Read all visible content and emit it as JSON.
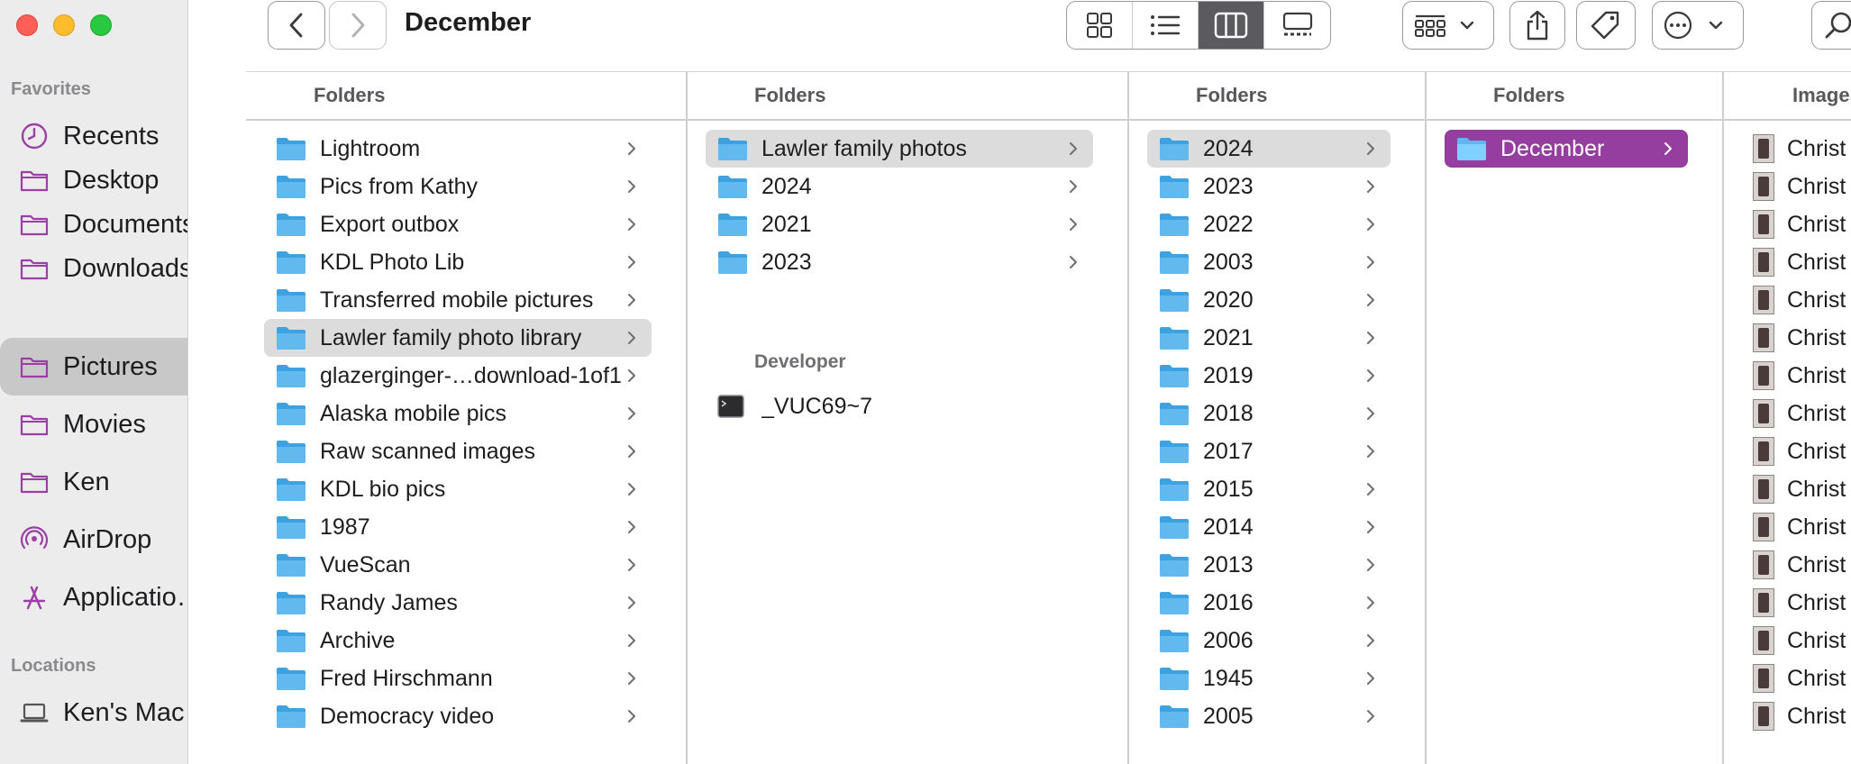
{
  "window": {
    "title": "December"
  },
  "sidebar": {
    "sections": [
      {
        "label": "Favorites",
        "items": [
          {
            "label": "Recents",
            "icon": "clock-icon",
            "selected": false
          },
          {
            "label": "Desktop",
            "icon": "folder-icon",
            "selected": false
          },
          {
            "label": "Documents",
            "icon": "folder-icon",
            "selected": false
          },
          {
            "label": "Downloads",
            "icon": "folder-icon",
            "selected": false
          },
          {
            "label": "Pictures",
            "icon": "folder-icon",
            "selected": true
          },
          {
            "label": "Movies",
            "icon": "folder-icon",
            "selected": false
          },
          {
            "label": "Ken",
            "icon": "folder-icon",
            "selected": false
          },
          {
            "label": "AirDrop",
            "icon": "airdrop-icon",
            "selected": false
          },
          {
            "label": "Applicatio…",
            "icon": "applications-icon",
            "selected": false
          }
        ]
      },
      {
        "label": "Locations",
        "items": [
          {
            "label": "Ken's Mac…",
            "icon": "laptop-icon",
            "selected": false
          }
        ]
      }
    ]
  },
  "toolbar": {
    "back": "chevron-left-icon",
    "forward": "chevron-right-icon",
    "views": [
      "icon-view-icon",
      "list-view-icon",
      "column-view-icon",
      "gallery-view-icon"
    ],
    "active_view": "column-view-icon",
    "group": "group-by-icon",
    "share": "share-icon",
    "tags": "tag-icon",
    "more": "more-icon",
    "search": "search-icon"
  },
  "columns": [
    {
      "header": "Folders",
      "items": [
        {
          "label": "Lightroom",
          "selected": ""
        },
        {
          "label": "Pics from Kathy",
          "selected": ""
        },
        {
          "label": "Export outbox",
          "selected": ""
        },
        {
          "label": "KDL Photo Lib",
          "selected": ""
        },
        {
          "label": "Transferred mobile pictures",
          "selected": ""
        },
        {
          "label": "Lawler family photo library",
          "selected": "gray"
        },
        {
          "label": "glazerginger-…download-1of1",
          "selected": ""
        },
        {
          "label": "Alaska mobile pics",
          "selected": ""
        },
        {
          "label": "Raw scanned images",
          "selected": ""
        },
        {
          "label": "KDL bio pics",
          "selected": ""
        },
        {
          "label": "1987",
          "selected": ""
        },
        {
          "label": "VueScan",
          "selected": ""
        },
        {
          "label": "Randy James",
          "selected": ""
        },
        {
          "label": "Archive",
          "selected": ""
        },
        {
          "label": "Fred Hirschmann",
          "selected": ""
        },
        {
          "label": "Democracy video",
          "selected": ""
        }
      ]
    },
    {
      "header": "Folders",
      "items": [
        {
          "label": "Lawler family photos",
          "selected": "gray"
        },
        {
          "label": "2024",
          "selected": ""
        },
        {
          "label": "2021",
          "selected": ""
        },
        {
          "label": "2023",
          "selected": ""
        }
      ],
      "subsection": {
        "header": "Developer",
        "items": [
          {
            "label": "_VUC69~7",
            "icon": "terminal-icon"
          }
        ]
      }
    },
    {
      "header": "Folders",
      "items": [
        {
          "label": "2024",
          "selected": "gray"
        },
        {
          "label": "2023",
          "selected": ""
        },
        {
          "label": "2022",
          "selected": ""
        },
        {
          "label": "2003",
          "selected": ""
        },
        {
          "label": "2020",
          "selected": ""
        },
        {
          "label": "2021",
          "selected": ""
        },
        {
          "label": "2019",
          "selected": ""
        },
        {
          "label": "2018",
          "selected": ""
        },
        {
          "label": "2017",
          "selected": ""
        },
        {
          "label": "2015",
          "selected": ""
        },
        {
          "label": "2014",
          "selected": ""
        },
        {
          "label": "2013",
          "selected": ""
        },
        {
          "label": "2016",
          "selected": ""
        },
        {
          "label": "2006",
          "selected": ""
        },
        {
          "label": "1945",
          "selected": ""
        },
        {
          "label": "2005",
          "selected": ""
        }
      ]
    },
    {
      "header": "Folders",
      "items": [
        {
          "label": "December",
          "selected": "purple"
        }
      ]
    },
    {
      "header": "Images",
      "items": [
        {
          "label": "Christ"
        },
        {
          "label": "Christ"
        },
        {
          "label": "Christ"
        },
        {
          "label": "Christ"
        },
        {
          "label": "Christ"
        },
        {
          "label": "Christ"
        },
        {
          "label": "Christ"
        },
        {
          "label": "Christ"
        },
        {
          "label": "Christ"
        },
        {
          "label": "Christ"
        },
        {
          "label": "Christ"
        },
        {
          "label": "Christ"
        },
        {
          "label": "Christ"
        },
        {
          "label": "Christ"
        },
        {
          "label": "Christ"
        },
        {
          "label": "Christ"
        }
      ]
    }
  ],
  "colors": {
    "accent": "#953e9f",
    "sidebar_icon": "#9b3fa5",
    "folder": "#5cb8ec"
  }
}
